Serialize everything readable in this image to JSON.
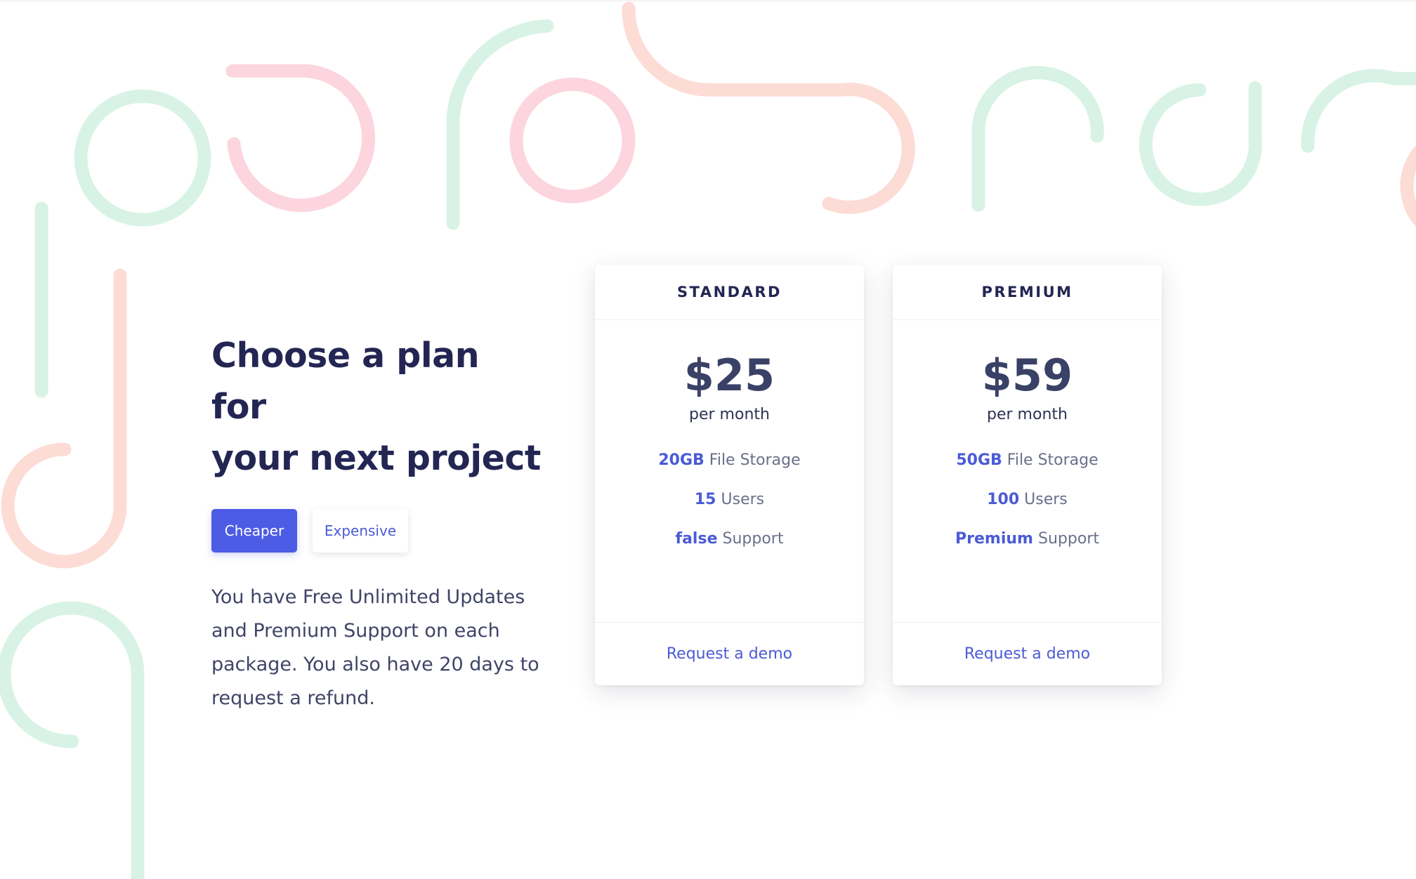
{
  "intro": {
    "title_line1": "Choose a plan for",
    "title_line2": "your next project",
    "toggle": {
      "cheaper_label": "Cheaper",
      "expensive_label": "Expensive"
    },
    "description": "You have Free Unlimited Updates and Premium Support on each package. You also have 20 days to request a refund."
  },
  "plans": [
    {
      "name": "STANDARD",
      "price": "$25",
      "period": "per month",
      "features": [
        {
          "value": "20GB",
          "label": "File Storage"
        },
        {
          "value": "15",
          "label": "Users"
        },
        {
          "value": "false",
          "label": "Support"
        }
      ],
      "cta": "Request a demo"
    },
    {
      "name": "PREMIUM",
      "price": "$59",
      "period": "per month",
      "features": [
        {
          "value": "50GB",
          "label": "File Storage"
        },
        {
          "value": "100",
          "label": "Users"
        },
        {
          "value": "Premium",
          "label": "Support"
        }
      ],
      "cta": "Request a demo"
    }
  ],
  "colors": {
    "accent": "#4c5ce4",
    "heading": "#232653",
    "decor_green": "#d8f3e6",
    "decor_pink": "#fcd5de",
    "decor_peach": "#fddcd6"
  }
}
